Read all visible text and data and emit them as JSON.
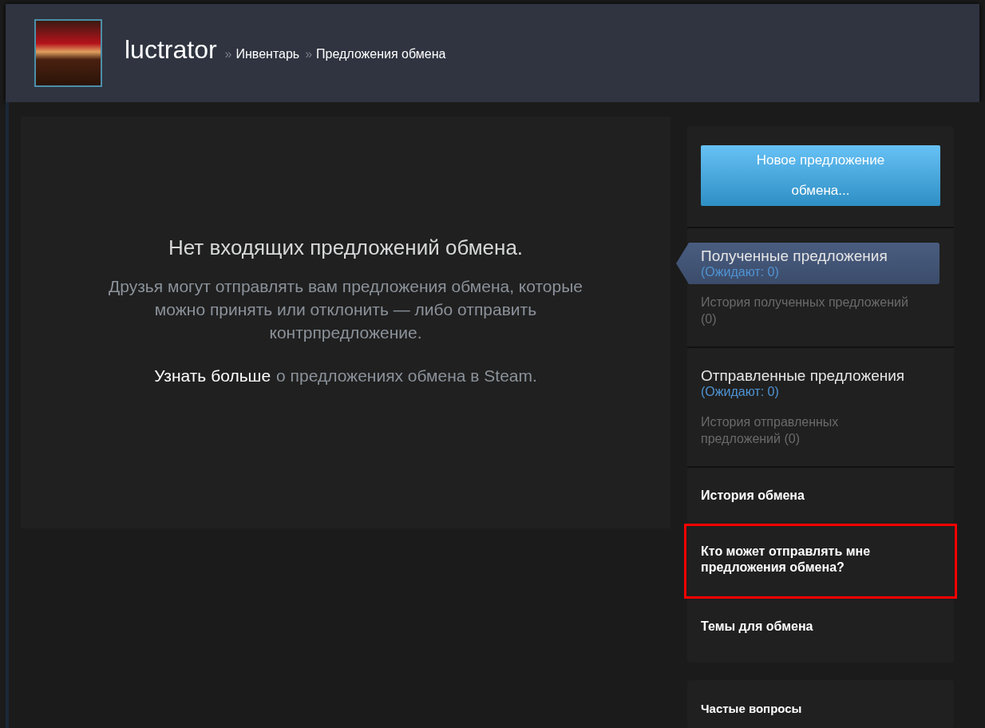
{
  "header": {
    "username": "luctrator",
    "breadcrumbs": [
      {
        "separator": "»",
        "label": "Инвентарь"
      },
      {
        "separator": "»",
        "label": "Предложения обмена"
      }
    ]
  },
  "main": {
    "title": "Нет входящих предложений обмена.",
    "description": "Друзья могут отправлять вам предложения обмена, которые можно принять или отклонить — либо отправить контрпредложение.",
    "learn_more_link": "Узнать больше",
    "learn_more_rest": "о предложениях обмена в Steam."
  },
  "sidebar": {
    "new_offer_button": "Новое предложение обмена...",
    "sections": [
      {
        "title": "Полученные предложения",
        "pending": "(Ожидают: 0)",
        "history": "История полученных предложений (0)",
        "selected": true
      },
      {
        "title": "Отправленные предложения",
        "pending": "(Ожидают: 0)",
        "history": "История отправленных предложений (0)",
        "selected": false
      }
    ],
    "links": [
      {
        "label": "История обмена",
        "highlighted": false
      },
      {
        "label": "Кто может отправлять мне предложения обмена?",
        "highlighted": true
      },
      {
        "label": "Темы для обмена",
        "highlighted": false
      }
    ],
    "faq_title": "Частые вопросы"
  }
}
